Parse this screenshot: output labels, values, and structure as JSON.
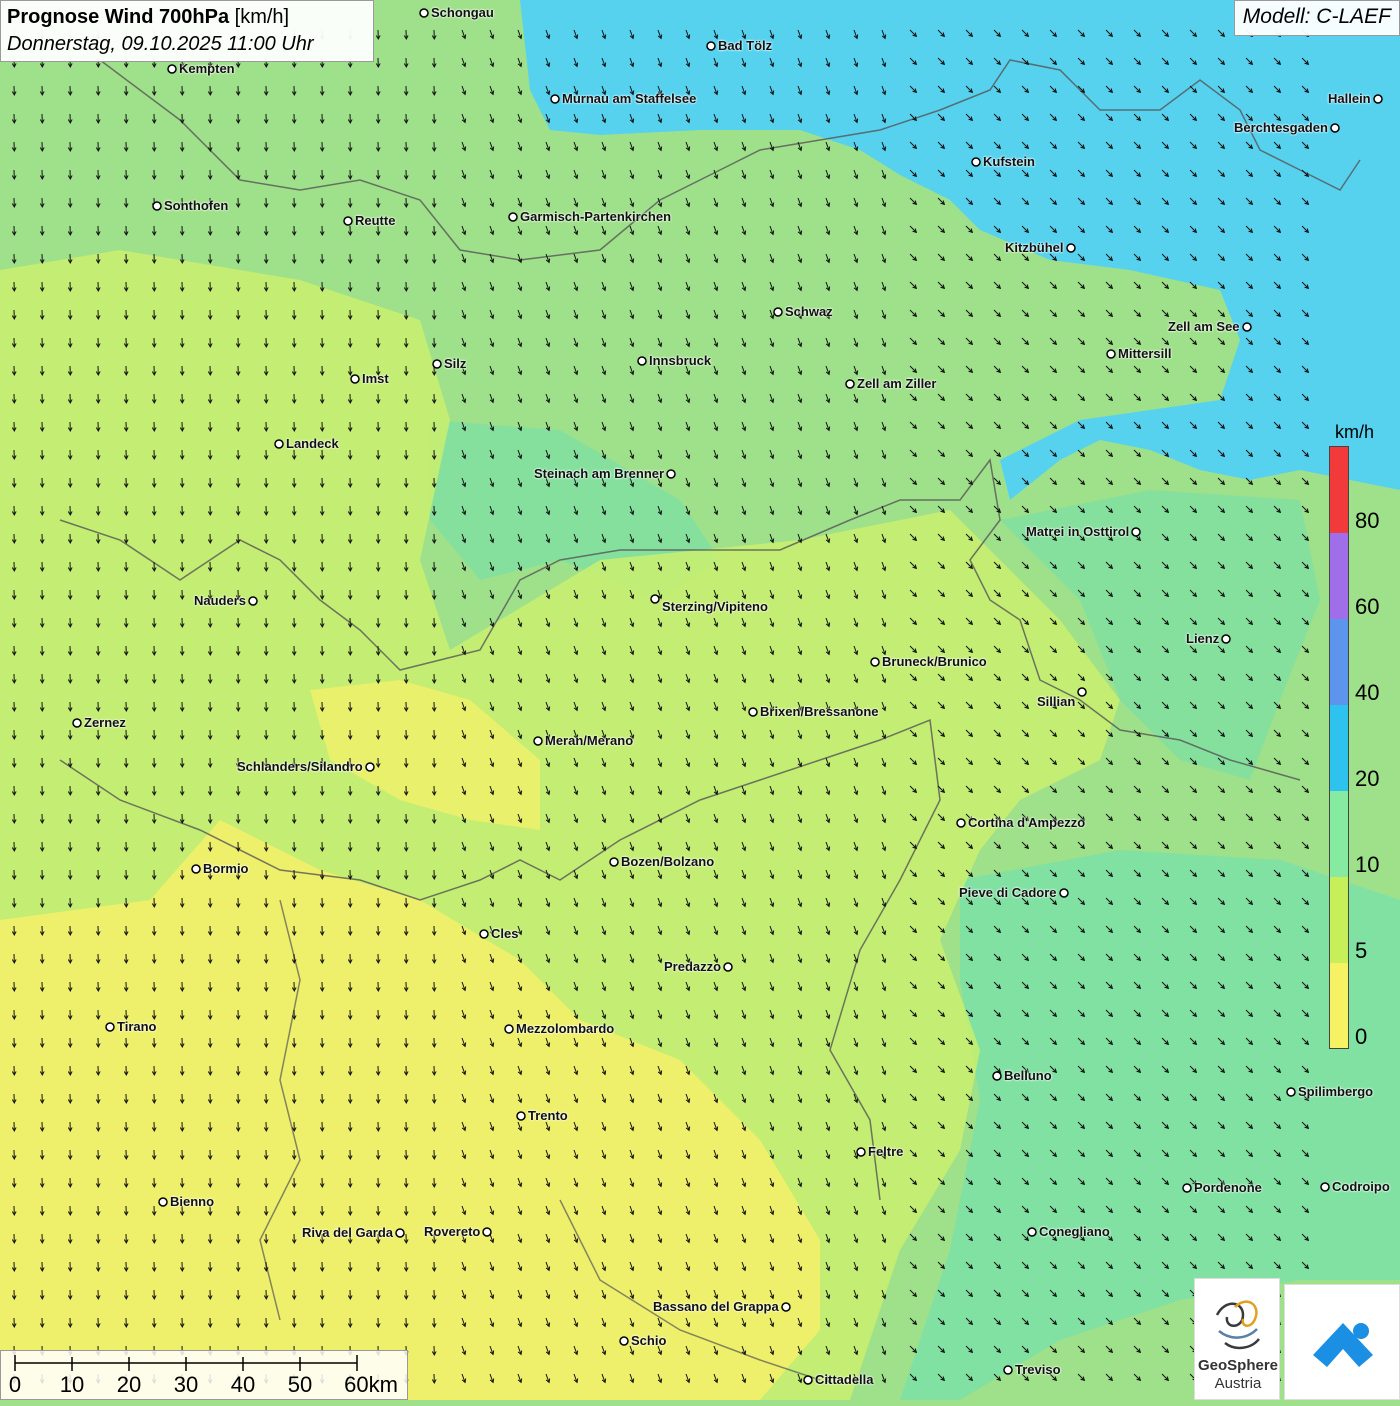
{
  "title": {
    "main": "Prognose Wind 700hPa",
    "unit": "[km/h]",
    "datetime": "Donnerstag, 09.10.2025 11:00 Uhr"
  },
  "model": "Modell: C-LAEF",
  "legend": {
    "unit": "km/h",
    "labels": [
      "80",
      "60",
      "40",
      "20",
      "10",
      "5",
      "0"
    ],
    "colors": [
      "#f23a3a",
      "#a06ee8",
      "#5c94ee",
      "#2ec3ef",
      "#86eba0",
      "#c6ef5a",
      "#f7f264"
    ]
  },
  "scale_bar": {
    "labels": [
      "0",
      "10",
      "20",
      "30",
      "40",
      "50",
      "60km"
    ]
  },
  "logos": {
    "geosphere_name": "GeoSphere",
    "geosphere_sub": "Austria"
  },
  "field_colors": {
    "calm": "#f3f06a",
    "light": "#c9ef6e",
    "moderate": "#9fe08a",
    "fresh": "#7ae0a6",
    "strong": "#56d2ef",
    "border": "#555555"
  },
  "cities": [
    {
      "name": "Schongau"
    },
    {
      "name": "Bad Tölz"
    },
    {
      "name": "Kempten"
    },
    {
      "name": "Murnau am Staffelsee"
    },
    {
      "name": "Hallein"
    },
    {
      "name": "Berchtesgaden"
    },
    {
      "name": "Kufstein"
    },
    {
      "name": "Sonthofen"
    },
    {
      "name": "Reutte"
    },
    {
      "name": "Garmisch-Partenkirchen"
    },
    {
      "name": "Kitzbühel"
    },
    {
      "name": "Schwaz"
    },
    {
      "name": "Zell am See"
    },
    {
      "name": "Mittersill"
    },
    {
      "name": "Innsbruck"
    },
    {
      "name": "Silz"
    },
    {
      "name": "Imst"
    },
    {
      "name": "Zell am Ziller"
    },
    {
      "name": "Landeck"
    },
    {
      "name": "Steinach am Brenner"
    },
    {
      "name": "Matrei in Osttirol"
    },
    {
      "name": "Nauders"
    },
    {
      "name": "Sterzing/Vipiteno"
    },
    {
      "name": "Lienz"
    },
    {
      "name": "Bruneck/Brunico"
    },
    {
      "name": "Sillian"
    },
    {
      "name": "Zernez"
    },
    {
      "name": "Brixen/Bressanone"
    },
    {
      "name": "Meran/Merano"
    },
    {
      "name": "Schlanders/Silandro"
    },
    {
      "name": "Cortina d'Ampezzo"
    },
    {
      "name": "Bormio"
    },
    {
      "name": "Bozen/Bolzano"
    },
    {
      "name": "Pieve di Cadore"
    },
    {
      "name": "Cles"
    },
    {
      "name": "Predazzo"
    },
    {
      "name": "Tirano"
    },
    {
      "name": "Mezzolombardo"
    },
    {
      "name": "Belluno"
    },
    {
      "name": "Spilimbergo"
    },
    {
      "name": "Trento"
    },
    {
      "name": "Feltre"
    },
    {
      "name": "Pordenone"
    },
    {
      "name": "Codroipo"
    },
    {
      "name": "Bienno"
    },
    {
      "name": "Riva del Garda"
    },
    {
      "name": "Rovereto"
    },
    {
      "name": "Conegliano"
    },
    {
      "name": "Bassano del Grappa"
    },
    {
      "name": "Schio"
    },
    {
      "name": "Treviso"
    },
    {
      "name": "Cittadella"
    }
  ]
}
